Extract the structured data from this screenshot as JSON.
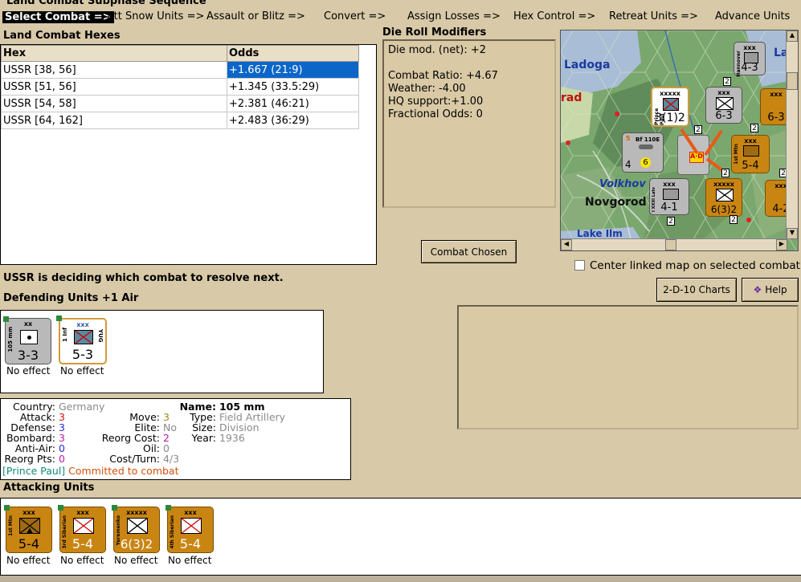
{
  "window": {
    "title": "Land Combat Subphase Sequence"
  },
  "sequence": [
    "Select Combat =>",
    "Att Snow Units =>",
    "Assault or Blitz =>",
    "Convert =>",
    "Assign Losses =>",
    "Hex Control =>",
    "Retreat Units =>",
    "Advance Units"
  ],
  "hexes": {
    "label": "Land Combat Hexes",
    "headers": [
      "Hex",
      "Odds"
    ],
    "rows": [
      {
        "hex": "USSR [38, 56]",
        "odds": "+1.667 (21:9)"
      },
      {
        "hex": "USSR [51, 56]",
        "odds": "+1.345 (33.5:29)"
      },
      {
        "hex": "USSR [54, 58]",
        "odds": "+2.381 (46:21)"
      },
      {
        "hex": "USSR [64, 162]",
        "odds": "+2.483 (36:29)"
      }
    ]
  },
  "modifiers": {
    "label": "Die Roll Modifiers",
    "net": "Die mod. (net): +2",
    "ratio": "Combat Ratio: +4.67",
    "weather": "Weather: -4.00",
    "hq": "HQ support:+1.00",
    "fractional": "Fractional Odds: 0"
  },
  "combat_chosen_button": "Combat Chosen",
  "center_checkbox": "Center linked map on selected combat.",
  "charts_button": "2-D-10 Charts",
  "help_button": "Help",
  "status_text": "USSR is deciding which combat to resolve next.",
  "defending": {
    "label": "Defending Units +1 Air",
    "units": [
      {
        "size": "xx",
        "side": "105 mm",
        "values": "3-3",
        "effect": "No effect"
      },
      {
        "size": "xxx",
        "side": "1 Inf",
        "rside": "YUG",
        "values": "5-3",
        "effect": "No effect"
      }
    ]
  },
  "unit_info": {
    "country_label": "Country:",
    "country": "Germany",
    "attack_label": "Attack:",
    "attack": "3",
    "defense_label": "Defense:",
    "defense": "3",
    "bombard_label": "Bombard:",
    "bombard": "3",
    "antiair_label": "Anti-Air:",
    "antiair": "0",
    "reorgpts_label": "Reorg Pts:",
    "reorgpts": "0",
    "move_label": "Move:",
    "move": "3",
    "elite_label": "Elite:",
    "elite": "No",
    "reorgcost_label": "Reorg Cost:",
    "reorgcost": "2",
    "oil_label": "Oil:",
    "oil": "0",
    "costturn_label": "Cost/Turn:",
    "costturn": "4/3",
    "name_label": "Name:",
    "name": "105 mm",
    "type_label": "Type:",
    "type": "Field Artillery",
    "size_label": "Size:",
    "size": "Division",
    "year_label": "Year:",
    "year": "1936",
    "hq_note": "[Prince Paul]",
    "committed": "Committed to combat"
  },
  "attacking": {
    "label": "Attacking Units",
    "units": [
      {
        "size": "xxx",
        "side": "1st Mtn",
        "values": "5-4",
        "effect": "No effect"
      },
      {
        "size": "xxx",
        "side": "3rd Siberian",
        "values": "5-4",
        "effect": "No effect"
      },
      {
        "size": "xxxxx",
        "side": "Yeremenko",
        "values": "6(3)2",
        "effect": "No effect"
      },
      {
        "size": "xxx",
        "side": "4th Siberian",
        "values": "5-4",
        "effect": "No effect"
      }
    ]
  },
  "map": {
    "labels": {
      "ladoga": "Ladoga",
      "la": "La",
      "rad": "rad",
      "volkhov": "Volkhov",
      "novgorod": "Novgorod",
      "lakeilm": "Lake Ilm"
    },
    "counters": [
      {
        "values": "4-3",
        "side": "Hannover",
        "size": "xxx"
      },
      {
        "values": "3(1)2",
        "side": "Prince Paul",
        "size": "xxxxx"
      },
      {
        "values": "6-3",
        "size": "xxx"
      },
      {
        "values": "6-3",
        "size": "xxx"
      },
      {
        "values": "4",
        "side": "Bf 110E",
        "size": "5"
      },
      {
        "values": "5-4",
        "side": "1st Mtn",
        "size": "xxx"
      },
      {
        "values": "4-1",
        "side": "I XXXI Latv",
        "size": "xxx"
      },
      {
        "values": "6(3)2",
        "size": "xxxxx"
      },
      {
        "values": "4-2",
        "size": "xxx"
      }
    ],
    "stack_badges": [
      "2",
      "2",
      "2",
      "2",
      "2",
      "2",
      "2"
    ]
  }
}
